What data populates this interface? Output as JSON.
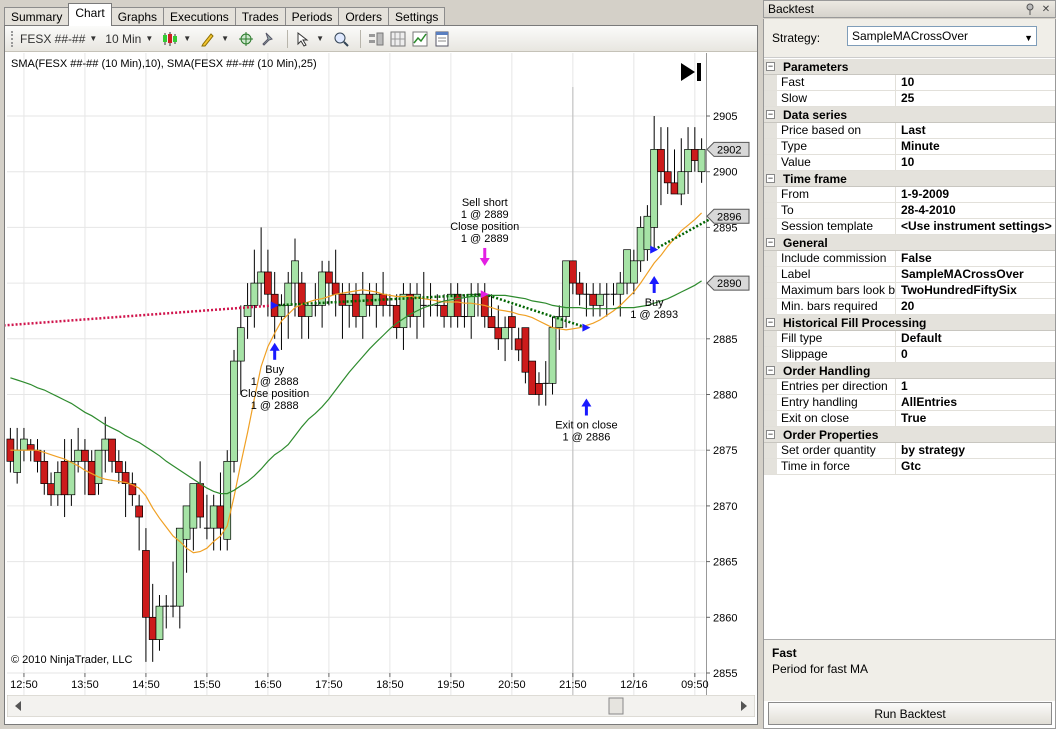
{
  "tabs": [
    {
      "label": "Summary",
      "active": false
    },
    {
      "label": "Chart",
      "active": true
    },
    {
      "label": "Graphs",
      "active": false
    },
    {
      "label": "Executions",
      "active": false
    },
    {
      "label": "Trades",
      "active": false
    },
    {
      "label": "Periods",
      "active": false
    },
    {
      "label": "Orders",
      "active": false
    },
    {
      "label": "Settings",
      "active": false
    }
  ],
  "toolbar": {
    "instrument": "FESX ##-##",
    "interval": "10 Min",
    "icons": [
      "candlestick-icon",
      "pencil-icon",
      "crosshair-icon",
      "pin-icon",
      "pointer-icon",
      "zoom-icon",
      "bars-icon",
      "grid-icon",
      "chart-icon",
      "panel-icon"
    ]
  },
  "chart": {
    "indicator_label": "SMA(FESX ##-## (10 Min),10), SMA(FESX ##-## (10 Min),25)",
    "copyright": "© 2010 NinjaTrader, LLC",
    "colors": {
      "up": "#a6e3a6",
      "down": "#cc1b1b",
      "sma_fast": "#f0a024",
      "sma_slow": "#2e8b2e",
      "trade_line": "#006400",
      "entry_line": "#d0144c",
      "buy_arrow": "#1a1aff",
      "sell_arrow": "#e31fe3"
    },
    "annotations": [
      {
        "lines": [
          "Buy",
          "1 @ 2888",
          "Close position",
          "1 @ 2888"
        ],
        "x": 39,
        "y": 2885,
        "side": "below",
        "arrow": "up",
        "color": "#1a1aff"
      },
      {
        "lines": [
          "Sell short",
          "1 @ 2889",
          "Close position",
          "1 @ 2889"
        ],
        "x": 70,
        "y": 2891,
        "side": "above",
        "arrow": "down",
        "color": "#e31fe3"
      },
      {
        "lines": [
          "Exit on close",
          "1 @ 2886"
        ],
        "x": 85,
        "y": 2880,
        "side": "below",
        "arrow": "up",
        "color": "#1a1aff"
      },
      {
        "lines": [
          "Buy",
          "1 @ 2893"
        ],
        "x": 95,
        "y": 2891,
        "side": "below",
        "arrow": "up",
        "color": "#1a1aff"
      }
    ],
    "price_tags": [
      {
        "label": "2902",
        "y": 2902
      },
      {
        "label": "2896",
        "y": 2896
      },
      {
        "label": "2890",
        "y": 2890
      }
    ]
  },
  "chart_data": {
    "type": "candlestick",
    "ylim": [
      2854,
      2907
    ],
    "y_ticks": [
      2855,
      2860,
      2865,
      2870,
      2875,
      2880,
      2885,
      2890,
      2895,
      2900,
      2905
    ],
    "x_tick_labels": [
      {
        "label": "12:50",
        "x": 2
      },
      {
        "label": "13:50",
        "x": 11
      },
      {
        "label": "14:50",
        "x": 20
      },
      {
        "label": "15:50",
        "x": 29
      },
      {
        "label": "16:50",
        "x": 38
      },
      {
        "label": "17:50",
        "x": 47
      },
      {
        "label": "18:50",
        "x": 56
      },
      {
        "label": "19:50",
        "x": 65
      },
      {
        "label": "20:50",
        "x": 74
      },
      {
        "label": "21:50",
        "x": 83
      },
      {
        "label": "12/16",
        "x": 92
      },
      {
        "label": "09:50",
        "x": 101
      }
    ],
    "ohlc": [
      [
        2876,
        2877,
        2873,
        2874
      ],
      [
        2873,
        2877,
        2872,
        2875
      ],
      [
        2875,
        2877,
        2874,
        2876
      ],
      [
        2875.5,
        2876,
        2874,
        2875
      ],
      [
        2875,
        2876,
        2873,
        2874
      ],
      [
        2874,
        2875,
        2871,
        2872
      ],
      [
        2872,
        2873,
        2870,
        2871
      ],
      [
        2871,
        2874,
        2870,
        2873
      ],
      [
        2874,
        2876,
        2869,
        2871
      ],
      [
        2871,
        2876,
        2870,
        2874
      ],
      [
        2874,
        2877,
        2873,
        2875
      ],
      [
        2875,
        2876,
        2871,
        2874
      ],
      [
        2874,
        2875,
        2871,
        2871
      ],
      [
        2872,
        2875,
        2871,
        2875
      ],
      [
        2875,
        2878,
        2873,
        2876
      ],
      [
        2876,
        2876,
        2873,
        2874
      ],
      [
        2874,
        2875,
        2872,
        2873
      ],
      [
        2873,
        2874,
        2869,
        2872
      ],
      [
        2872,
        2873,
        2870,
        2871
      ],
      [
        2870,
        2871,
        2866,
        2869
      ],
      [
        2866,
        2868,
        2856,
        2860
      ],
      [
        2860,
        2863,
        2856,
        2858
      ],
      [
        2858,
        2862,
        2857,
        2861
      ],
      [
        2861,
        2862,
        2859,
        2861
      ],
      [
        2861,
        2865,
        2860,
        2861
      ],
      [
        2861,
        2866,
        2859,
        2868
      ],
      [
        2867,
        2870,
        2864,
        2870
      ],
      [
        2868,
        2872,
        2866,
        2872
      ],
      [
        2872,
        2874,
        2868,
        2869
      ],
      [
        2868,
        2871,
        2867,
        2868
      ],
      [
        2868,
        2871,
        2866,
        2870
      ],
      [
        2870,
        2873,
        2866,
        2868
      ],
      [
        2867,
        2875,
        2866,
        2874
      ],
      [
        2874,
        2884,
        2873,
        2883
      ],
      [
        2883,
        2888,
        2880,
        2886
      ],
      [
        2887,
        2890,
        2885,
        2888
      ],
      [
        2888,
        2893,
        2886,
        2890
      ],
      [
        2890,
        2895,
        2888,
        2891
      ],
      [
        2891,
        2893,
        2887,
        2889
      ],
      [
        2889,
        2891,
        2885,
        2887
      ],
      [
        2887,
        2889,
        2884,
        2888
      ],
      [
        2888,
        2891,
        2885,
        2890
      ],
      [
        2890,
        2894,
        2887,
        2892
      ],
      [
        2890,
        2891,
        2885,
        2887
      ],
      [
        2887,
        2888,
        2885,
        2888
      ],
      [
        2888,
        2890,
        2887,
        2888
      ],
      [
        2888,
        2892,
        2886,
        2891
      ],
      [
        2891,
        2892,
        2888,
        2890
      ],
      [
        2890,
        2893,
        2887,
        2889
      ],
      [
        2889,
        2890,
        2885,
        2888
      ],
      [
        2888,
        2890,
        2886,
        2889
      ],
      [
        2889,
        2890,
        2886,
        2887
      ],
      [
        2887,
        2891,
        2885,
        2889
      ],
      [
        2889,
        2890,
        2887,
        2888
      ],
      [
        2888,
        2890,
        2886,
        2889
      ],
      [
        2889,
        2891,
        2887,
        2888
      ],
      [
        2888,
        2889,
        2887,
        2888
      ],
      [
        2888,
        2889,
        2885,
        2886
      ],
      [
        2886,
        2890,
        2884,
        2889
      ],
      [
        2889,
        2890,
        2886,
        2887
      ],
      [
        2887,
        2890,
        2885,
        2889
      ],
      [
        2888,
        2891,
        2886,
        2888
      ],
      [
        2888,
        2890,
        2887,
        2888
      ],
      [
        2888,
        2889,
        2887,
        2888
      ],
      [
        2888,
        2889,
        2886,
        2887
      ],
      [
        2887,
        2890,
        2886,
        2889
      ],
      [
        2889,
        2890,
        2886,
        2887
      ],
      [
        2887,
        2889,
        2886,
        2887
      ],
      [
        2887,
        2890,
        2885,
        2889
      ],
      [
        2889,
        2890,
        2887,
        2889
      ],
      [
        2889,
        2890,
        2886,
        2887
      ],
      [
        2887,
        2889,
        2886,
        2886
      ],
      [
        2886,
        2888,
        2884,
        2885
      ],
      [
        2885,
        2887,
        2883,
        2886
      ],
      [
        2887,
        2888,
        2884,
        2886
      ],
      [
        2885,
        2886,
        2883,
        2884
      ],
      [
        2886,
        2885,
        2881,
        2882
      ],
      [
        2883,
        2883,
        2880,
        2880
      ],
      [
        2881,
        2882,
        2879,
        2880
      ],
      [
        2881,
        2883,
        2879,
        2881
      ],
      [
        2881,
        2887,
        2880,
        2886
      ],
      [
        2886,
        2888,
        2884,
        2887
      ],
      [
        2887,
        2892,
        2886,
        2892
      ],
      [
        2892,
        2892,
        2889,
        2890
      ],
      [
        2890,
        2891,
        2888,
        2889
      ],
      [
        2889,
        2890,
        2887,
        2889
      ],
      [
        2889,
        2890,
        2887,
        2888
      ],
      [
        2888,
        2890,
        2887,
        2889
      ],
      [
        2889,
        2890,
        2887,
        2889
      ],
      [
        2889,
        2890,
        2888,
        2889
      ],
      [
        2889,
        2891,
        2887,
        2890
      ],
      [
        2890,
        2893,
        2889,
        2893
      ],
      [
        2890,
        2893,
        2889,
        2892
      ],
      [
        2892,
        2896,
        2891,
        2895
      ],
      [
        2893,
        2897,
        2892,
        2896
      ],
      [
        2895,
        2905,
        2893,
        2902
      ],
      [
        2902,
        2904,
        2897,
        2900
      ],
      [
        2900,
        2904,
        2898,
        2899
      ],
      [
        2899,
        2902,
        2898,
        2898
      ],
      [
        2898,
        2903,
        2897,
        2900
      ],
      [
        2900,
        2904,
        2898,
        2902
      ],
      [
        2902,
        2904,
        2900,
        2901
      ],
      [
        2900,
        2903,
        2899,
        2902
      ]
    ],
    "series": [
      {
        "name": "SMA 10",
        "values": [
          2875,
          2875,
          2875,
          2875,
          2875,
          2874.8,
          2874.6,
          2874.4,
          2874.2,
          2873.9,
          2873.6,
          2873.2,
          2872.9,
          2872.6,
          2872.4,
          2872.3,
          2872.2,
          2872.1,
          2871.9,
          2871.6,
          2870.9,
          2869.8,
          2868.9,
          2868.1,
          2867.3,
          2866.8,
          2866.2,
          2865.8,
          2865.9,
          2866.2,
          2866.8,
          2867.3,
          2868.2,
          2870.8,
          2873.8,
          2876.6,
          2879.6,
          2882.5,
          2884.3,
          2885.5,
          2886.6,
          2887.2,
          2887.8,
          2888.1,
          2888.3,
          2888.5,
          2888.6,
          2888.8,
          2889,
          2889.1,
          2889.2,
          2889.3,
          2889.4,
          2889.3,
          2889.2,
          2889,
          2888.9,
          2888.8,
          2888.8,
          2888.8,
          2888.7,
          2888.6,
          2888.5,
          2888.4,
          2888.3,
          2888.3,
          2888.3,
          2888.2,
          2888.2,
          2888.1,
          2888,
          2887.8,
          2887.6,
          2887.5,
          2887.4,
          2887.2,
          2887.1,
          2886.9,
          2886.6,
          2886.3,
          2886,
          2885.9,
          2885.8,
          2885.9,
          2886,
          2886.2,
          2886.4,
          2886.7,
          2887.1,
          2887.5,
          2888,
          2888.6,
          2889.2,
          2890,
          2890.9,
          2891.8,
          2892.5,
          2893.3,
          2894,
          2894.7,
          2895.2,
          2895.7,
          2896.3
        ]
      },
      {
        "name": "SMA 25",
        "values": [
          2881.5,
          2881.3,
          2881.1,
          2880.9,
          2880.6,
          2880.4,
          2880.1,
          2879.8,
          2879.5,
          2879.2,
          2878.8,
          2878.4,
          2878.1,
          2877.7,
          2877.3,
          2877,
          2876.7,
          2876.3,
          2876,
          2875.7,
          2875.3,
          2874.9,
          2874.5,
          2874,
          2873.6,
          2873.2,
          2872.8,
          2872.4,
          2872,
          2871.6,
          2871.3,
          2871.1,
          2871.1,
          2871.4,
          2871.8,
          2872.2,
          2872.7,
          2873.3,
          2874,
          2874.6,
          2875,
          2875.5,
          2876.3,
          2877.1,
          2877.8,
          2878.3,
          2878.9,
          2879.6,
          2880.4,
          2881.2,
          2882,
          2882.7,
          2883.4,
          2884.1,
          2884.7,
          2885.3,
          2885.9,
          2886.4,
          2886.8,
          2887.2,
          2887.5,
          2887.8,
          2888,
          2888.2,
          2888.4,
          2888.5,
          2888.6,
          2888.7,
          2888.8,
          2888.8,
          2888.9,
          2888.9,
          2888.9,
          2888.9,
          2888.8,
          2888.7,
          2888.6,
          2888.4,
          2888.3,
          2888.2,
          2888,
          2887.9,
          2887.8,
          2887.8,
          2887.8,
          2887.7,
          2887.7,
          2887.7,
          2887.7,
          2887.7,
          2887.8,
          2887.8,
          2887.8,
          2887.9,
          2888,
          2888.2,
          2888.4,
          2888.6,
          2888.9,
          2889.2,
          2889.5,
          2889.8,
          2890.2
        ]
      }
    ],
    "trade_lines": [
      {
        "style": "dotted",
        "color": "#d0144c",
        "points": [
          [
            -1,
            2886.2
          ],
          [
            39,
            2888
          ]
        ]
      },
      {
        "style": "dotted",
        "color": "#006400",
        "points": [
          [
            39,
            2888
          ],
          [
            70,
            2889
          ]
        ]
      },
      {
        "style": "dotted",
        "color": "#006400",
        "points": [
          [
            70,
            2889
          ],
          [
            85,
            2886
          ]
        ]
      },
      {
        "style": "dotted",
        "color": "#006400",
        "points": [
          [
            95,
            2893
          ],
          [
            104,
            2896
          ]
        ]
      }
    ]
  },
  "backtest": {
    "title": "Backtest",
    "strategy_label": "Strategy:",
    "strategy_value": "SampleMACrossOver",
    "categories": [
      {
        "name": "Parameters",
        "rows": [
          {
            "name": "Fast",
            "value": "10"
          },
          {
            "name": "Slow",
            "value": "25"
          }
        ]
      },
      {
        "name": "Data series",
        "rows": [
          {
            "name": "Price based on",
            "value": "Last"
          },
          {
            "name": "Type",
            "value": "Minute"
          },
          {
            "name": "Value",
            "value": "10"
          }
        ]
      },
      {
        "name": "Time frame",
        "rows": [
          {
            "name": "From",
            "value": "1-9-2009"
          },
          {
            "name": "To",
            "value": "28-4-2010"
          },
          {
            "name": "Session template",
            "value": "<Use instrument settings>"
          }
        ]
      },
      {
        "name": "General",
        "rows": [
          {
            "name": "Include commission",
            "value": "False"
          },
          {
            "name": "Label",
            "value": "SampleMACrossOver"
          },
          {
            "name": "Maximum bars look back",
            "value": "TwoHundredFiftySix"
          },
          {
            "name": "Min. bars required",
            "value": "20"
          }
        ]
      },
      {
        "name": "Historical Fill Processing",
        "rows": [
          {
            "name": "Fill type",
            "value": "Default"
          },
          {
            "name": "Slippage",
            "value": "0"
          }
        ]
      },
      {
        "name": "Order Handling",
        "rows": [
          {
            "name": "Entries per direction",
            "value": "1"
          },
          {
            "name": "Entry handling",
            "value": "AllEntries"
          },
          {
            "name": "Exit on close",
            "value": "True"
          }
        ]
      },
      {
        "name": "Order Properties",
        "rows": [
          {
            "name": "Set order quantity",
            "value": "by strategy"
          },
          {
            "name": "Time in force",
            "value": "Gtc"
          }
        ]
      }
    ],
    "help_title": "Fast",
    "help_desc": "Period for fast MA",
    "run_label": "Run Backtest"
  }
}
